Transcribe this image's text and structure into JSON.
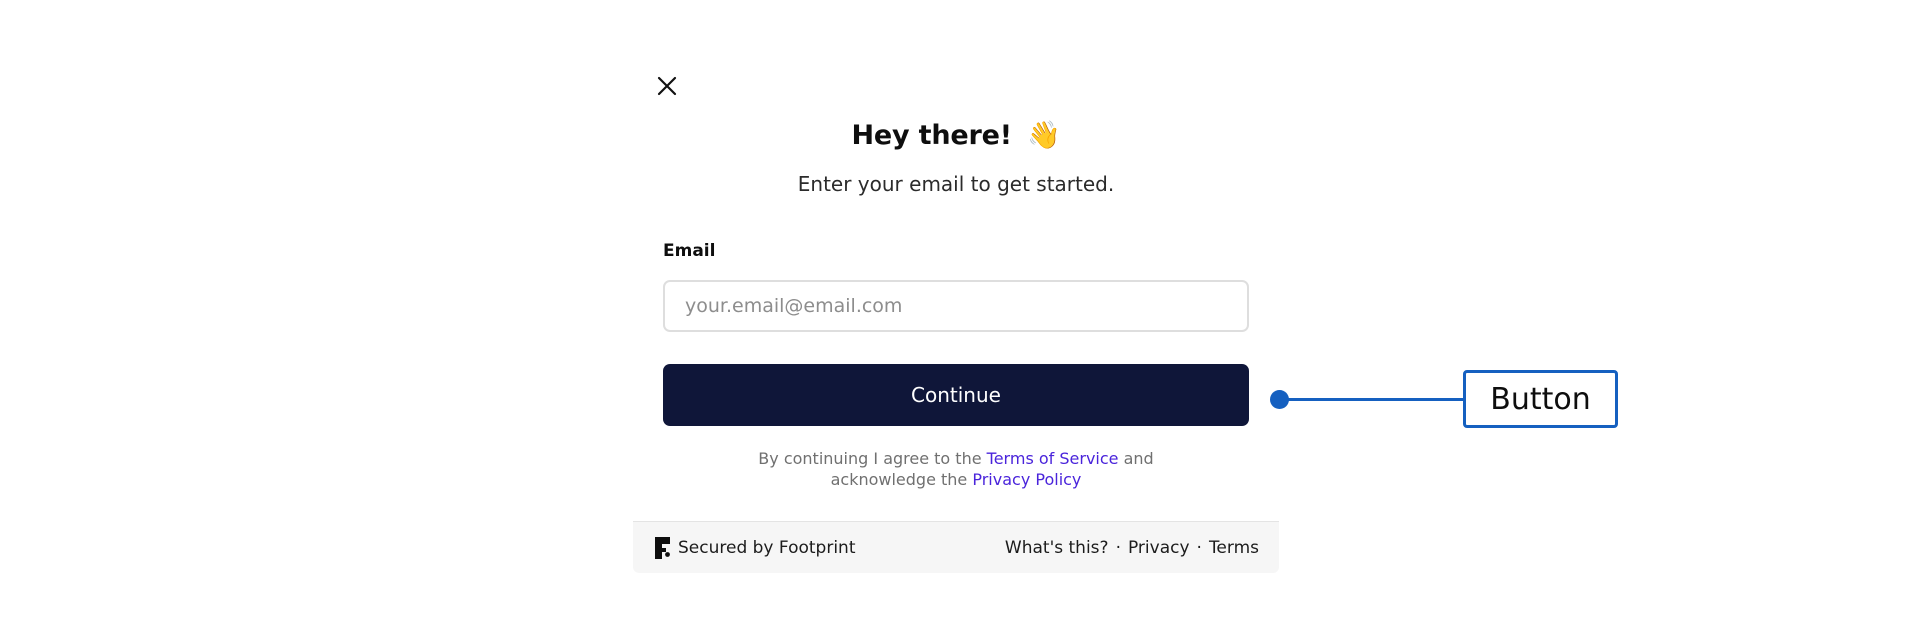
{
  "dialog": {
    "close_icon": "close-icon",
    "title": "Hey there!",
    "title_emoji": "👋",
    "subtitle": "Enter your email to get started.",
    "email_label": "Email",
    "email_placeholder": "your.email@email.com",
    "email_value": "",
    "continue_label": "Continue",
    "legal": {
      "prefix": "By continuing I agree to the",
      "terms_link": "Terms of Service",
      "middle": "and",
      "line2_prefix": "acknowledge the",
      "privacy_link": "Privacy Policy"
    }
  },
  "footer": {
    "logo_icon": "footprint-logo-icon",
    "secured_text": "Secured by Footprint",
    "links": {
      "whats_this": "What's this?",
      "privacy": "Privacy",
      "terms": "Terms"
    },
    "separator": "·"
  },
  "annotation": {
    "label": "Button"
  },
  "colors": {
    "button_bg": "#0f1639",
    "link": "#4a24db",
    "annotation": "#1560c0",
    "footer_bg": "#f6f6f6"
  }
}
